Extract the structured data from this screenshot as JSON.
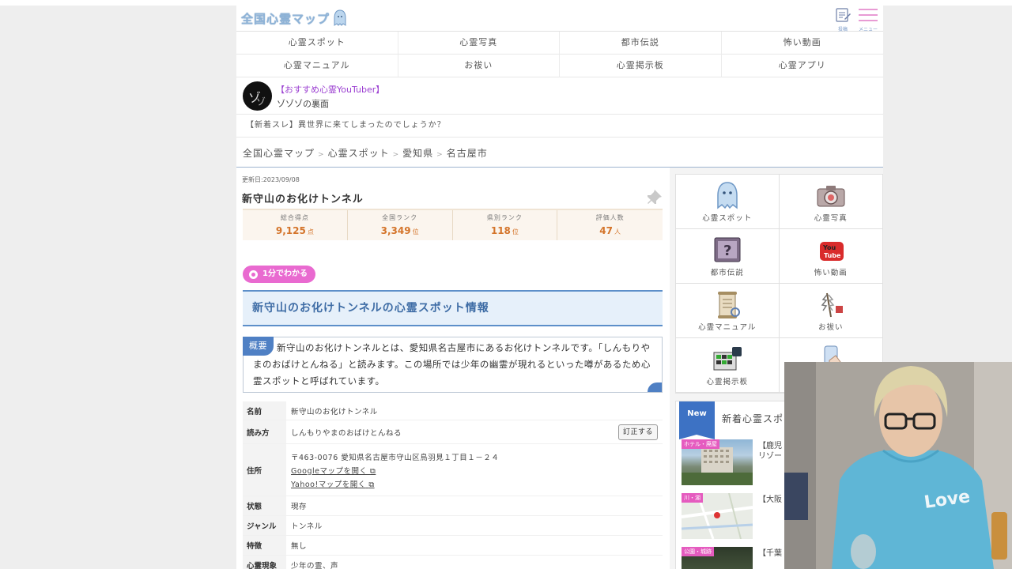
{
  "header": {
    "logo_text": "全国心霊マップ",
    "post_label": "投稿",
    "menu_label": "メニュー"
  },
  "nav": [
    "心霊スポット",
    "心霊写真",
    "都市伝説",
    "怖い動画",
    "心霊マニュアル",
    "お祓い",
    "心霊掲示板",
    "心霊アプリ"
  ],
  "youtuber": {
    "tag": "【おすすめ心霊YouTuber】",
    "name": "ゾゾゾの裏面"
  },
  "news": "【新着スレ】異世界に来てしまったのでしょうか？",
  "breadcrumb": [
    "全国心霊マップ",
    "心霊スポット",
    "愛知県",
    "名古屋市"
  ],
  "article": {
    "updated": "更新日:2023/09/08",
    "title": "新守山のお化けトンネル",
    "stats": [
      {
        "label": "総合得点",
        "value": "9,125",
        "unit": "点"
      },
      {
        "label": "全国ランク",
        "value": "3,349",
        "unit": "位"
      },
      {
        "label": "県別ランク",
        "value": "118",
        "unit": "位"
      },
      {
        "label": "評価人数",
        "value": "47",
        "unit": "人"
      }
    ],
    "pill": "1分でわかる",
    "info_heading": "新守山のお化けトンネルの心霊スポット情報",
    "summary_badge": "概要",
    "summary": "新守山のお化けトンネルとは、愛知県名古屋市にあるお化けトンネルです。「しんもりやまのおばけとんねる」と読みます。この場所では少年の幽霊が現れるといった噂があるため心霊スポットと呼ばれています。"
  },
  "details": {
    "name_label": "名前",
    "name": "新守山のお化けトンネル",
    "reading_label": "読み方",
    "reading": "しんもりやまのおばけとんねる",
    "fix_button": "訂正する",
    "address_label": "住所",
    "address": "〒463-0076 愛知県名古屋市守山区鳥羽見１丁目１－２４",
    "google_link": "Googleマップを開く",
    "yahoo_link": "Yahoo!マップを開く",
    "status_label": "状態",
    "status": "現存",
    "genre_label": "ジャンル",
    "genre": "トンネル",
    "feature_label": "特徴",
    "feature": "無し",
    "phenomena_label": "心霊現象",
    "phenomena": "少年の霊、声"
  },
  "side_grid": [
    {
      "label": "心霊スポット",
      "icon": "ghost-icon"
    },
    {
      "label": "心霊写真",
      "icon": "camera-icon"
    },
    {
      "label": "都市伝説",
      "icon": "question-icon"
    },
    {
      "label": "怖い動画",
      "icon": "youtube-icon"
    },
    {
      "label": "心霊マニュアル",
      "icon": "scroll-icon"
    },
    {
      "label": "お祓い",
      "icon": "purification-icon"
    },
    {
      "label": "心霊掲示板",
      "icon": "board-icon"
    },
    {
      "label": "",
      "icon": "app-icon"
    }
  ],
  "new_spots": {
    "badge": "New",
    "title": "新着心霊スポ",
    "items": [
      {
        "tag": "ホテル・廃屋",
        "text1": "【鹿児",
        "text2": "リゾー"
      },
      {
        "tag": "川・湖",
        "text1": "【大阪"
      },
      {
        "tag": "公園・城跡",
        "text1": "【千葉"
      }
    ]
  },
  "colors": {
    "accent_blue": "#3d72c4",
    "accent_pink": "#e96ad0",
    "score_orange": "#d4742a"
  }
}
